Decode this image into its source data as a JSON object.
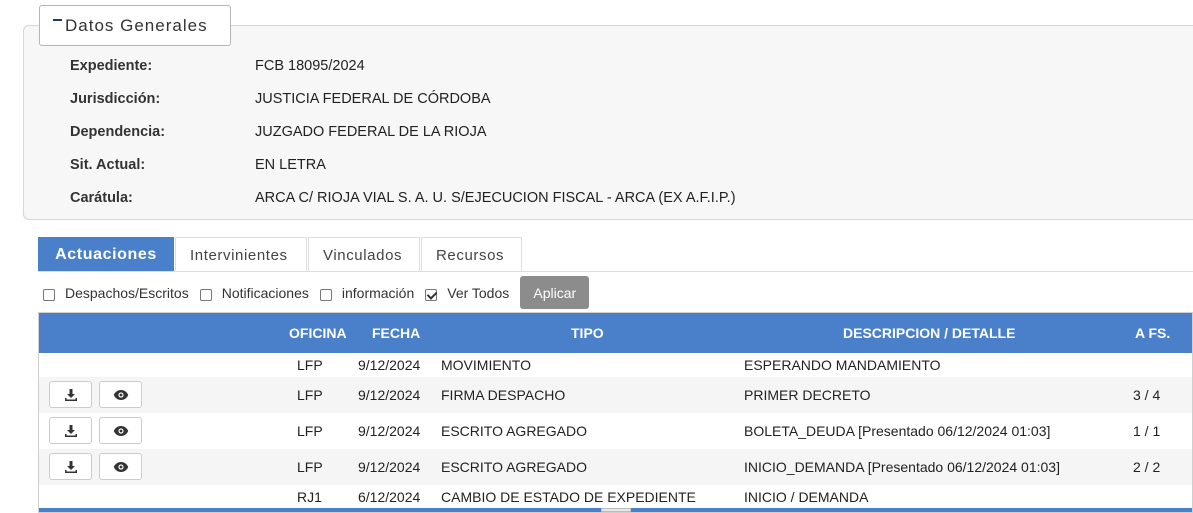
{
  "general": {
    "legend": "Datos Generales",
    "fields": [
      {
        "label": "Expediente:",
        "value": "FCB 18095/2024"
      },
      {
        "label": "Jurisdicción:",
        "value": "JUSTICIA FEDERAL DE CÓRDOBA"
      },
      {
        "label": "Dependencia:",
        "value": "JUZGADO FEDERAL DE LA RIOJA"
      },
      {
        "label": "Sit. Actual:",
        "value": "EN LETRA"
      },
      {
        "label": "Carátula:",
        "value": "ARCA C/ RIOJA VIAL S. A. U. S/EJECUCION FISCAL - ARCA (EX A.F.I.P.)"
      }
    ]
  },
  "tabs": [
    {
      "label": "Actuaciones",
      "active": true
    },
    {
      "label": "Intervinientes",
      "active": false
    },
    {
      "label": "Vinculados",
      "active": false
    },
    {
      "label": "Recursos",
      "active": false
    }
  ],
  "filters": {
    "items": [
      {
        "label": "Despachos/Escritos",
        "checked": false
      },
      {
        "label": "Notificaciones",
        "checked": false
      },
      {
        "label": "información",
        "checked": false
      },
      {
        "label": "Ver Todos",
        "checked": true
      }
    ],
    "apply_label": "Aplicar"
  },
  "table": {
    "headers": {
      "oficina": "OFICINA",
      "fecha": "FECHA",
      "tipo": "TIPO",
      "descripcion": "DESCRIPCION / DETALLE",
      "afs": "A FS."
    },
    "rows": [
      {
        "oficina": "LFP",
        "fecha": "9/12/2024",
        "tipo": "MOVIMIENTO",
        "descripcion": "ESPERANDO MANDAMIENTO",
        "afs": "",
        "actions": false
      },
      {
        "oficina": "LFP",
        "fecha": "9/12/2024",
        "tipo": "FIRMA DESPACHO",
        "descripcion": "PRIMER DECRETO",
        "afs": "3 / 4",
        "actions": true
      },
      {
        "oficina": "LFP",
        "fecha": "9/12/2024",
        "tipo": "ESCRITO AGREGADO",
        "descripcion": "BOLETA_DEUDA [Presentado 06/12/2024 01:03]",
        "afs": "1 / 1",
        "actions": true
      },
      {
        "oficina": "LFP",
        "fecha": "9/12/2024",
        "tipo": "ESCRITO AGREGADO",
        "descripcion": "INICIO_DEMANDA [Presentado 06/12/2024 01:03]",
        "afs": "2 / 2",
        "actions": true
      },
      {
        "oficina": "RJ1",
        "fecha": "6/12/2024",
        "tipo": "CAMBIO DE ESTADO DE EXPEDIENTE",
        "descripcion": "INICIO / DEMANDA",
        "afs": "",
        "actions": false
      }
    ],
    "action_icons": {
      "download": "download-icon",
      "view": "eye-icon"
    }
  },
  "colors": {
    "accent": "#4a80c9",
    "apply_button": "#8c8c8c"
  }
}
